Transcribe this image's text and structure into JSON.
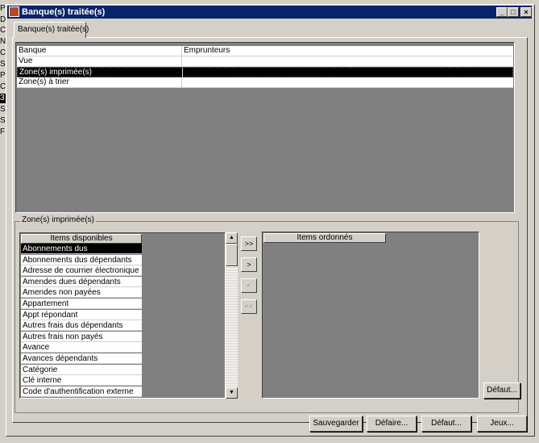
{
  "background_window": {
    "side_chars": [
      "P",
      "D",
      "C",
      "N",
      "C",
      "S",
      "P",
      "C",
      "3",
      "S",
      "S",
      "F"
    ]
  },
  "window": {
    "title": "Banque(s) traitée(s)",
    "controls": {
      "minimize": "_",
      "maximize": "□",
      "close": "×"
    }
  },
  "tabs": [
    {
      "label": "Banque(s) traitée(s)",
      "active": true
    }
  ],
  "grid": {
    "rows": [
      {
        "label": "Banque",
        "value": "Emprunteurs",
        "selected": false
      },
      {
        "label": "Vue",
        "value": "",
        "selected": false
      },
      {
        "label": "Zone(s) imprimée(s)",
        "value": "",
        "selected": true
      },
      {
        "label": "Zone(s) à trier",
        "value": "",
        "selected": false
      }
    ]
  },
  "printed_zones": {
    "group_title": "Zone(s) imprimée(s)",
    "available_header": "Items disponibles",
    "ordered_header": "Items ordonnés",
    "available_items": [
      "Abonnements dus",
      "Abonnements dus dépendants",
      "Adresse de courrier électronique",
      "Amendes dues dépendants",
      "Amendes non payées",
      "Appartement",
      "Appt répondant",
      "Autres frais dus dépendants",
      "Autres frais non payés",
      "Avance",
      "Avances dépendants",
      "Catégorie",
      "Clé interne",
      "Code d'authentification externe"
    ],
    "selected_item": "Abonnements dus",
    "ordered_items": [],
    "move_buttons": {
      "add_all": ">>",
      "add": ">",
      "remove": "<",
      "remove_all": "<<"
    },
    "default_button": "Défaut..."
  },
  "footer_buttons": {
    "save": "Sauvegarder",
    "undo": "Défaire...",
    "default": "Défaut...",
    "sets": "Jeux..."
  },
  "colors": {
    "title_bar": "#0a246a",
    "window_face": "#d4d0c8",
    "list_background": "#808080",
    "selection": "#000000"
  }
}
